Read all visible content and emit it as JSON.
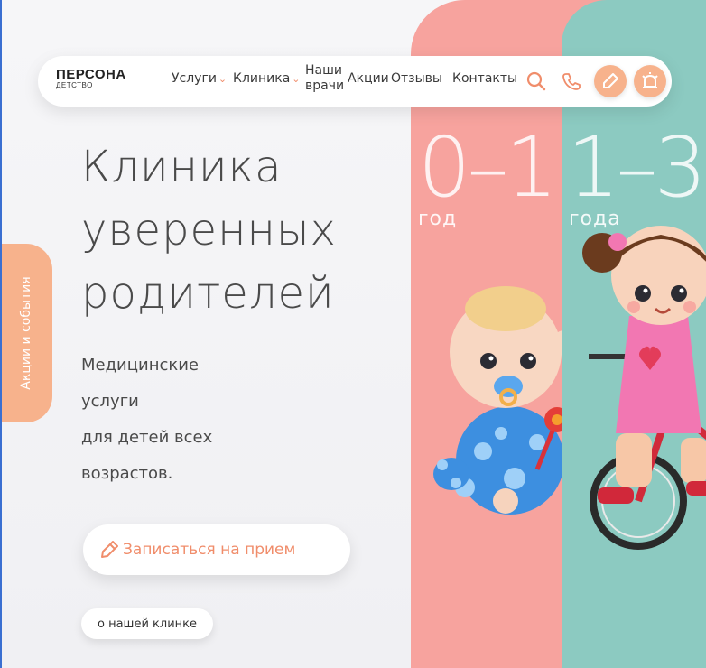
{
  "logo": {
    "main": "ПЕРСОНА",
    "sub": "ДЕТСТВО"
  },
  "nav": {
    "items": [
      {
        "label": "Услуги",
        "has_dropdown": true
      },
      {
        "label": "Клиника",
        "has_dropdown": true
      },
      {
        "label": "Наши врачи",
        "line1": "Наши",
        "line2": "врачи"
      },
      {
        "label": "Акции"
      },
      {
        "label": "Отзывы"
      },
      {
        "label": "Контакты"
      }
    ],
    "icons": [
      "search-icon",
      "phone-icon",
      "pen-icon",
      "alarm-icon"
    ]
  },
  "hero": {
    "title_line1": "Клиника",
    "title_line2": "уверенных",
    "title_line3": "родителей",
    "subtitle_line1": "Медицинские",
    "subtitle_line2": "услуги",
    "subtitle_line3": "для детей всех",
    "subtitle_line4": "возрастов."
  },
  "cta": {
    "label": "Записаться на прием"
  },
  "about": {
    "label": "о нашей клинке"
  },
  "side_tab": {
    "label": "Акции и события"
  },
  "age_panels": [
    {
      "range": "0–1",
      "unit": "год",
      "color": "#f7a39e"
    },
    {
      "range": "1–3",
      "unit": "года",
      "color": "#8ccac1"
    }
  ],
  "colors": {
    "accent": "#f08d6b",
    "button_fill": "#f7b28c",
    "text": "#4a4a4a",
    "background": "#f3f3f6"
  }
}
